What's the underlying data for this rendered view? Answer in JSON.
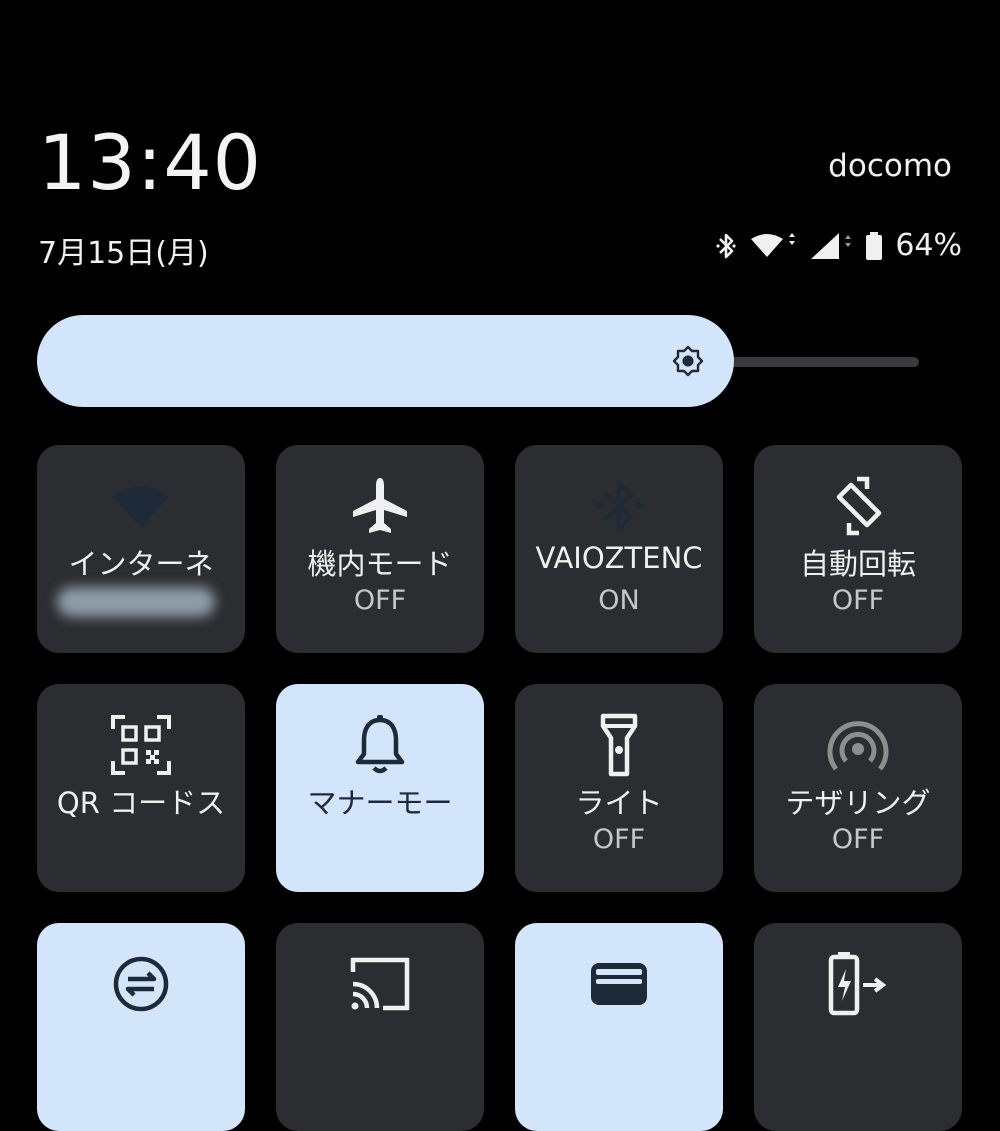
{
  "header": {
    "time": "13:40",
    "carrier": "docomo",
    "date": "7月15日(月)",
    "battery_percent": "64%"
  },
  "brightness": {
    "level": 0.79
  },
  "tiles": [
    {
      "label": "インターネ",
      "sub": "",
      "on": true,
      "icon": "wifi-icon"
    },
    {
      "label": "機内モード",
      "sub": "OFF",
      "on": false,
      "icon": "airplane-icon"
    },
    {
      "label": "VAIOZTENC",
      "sub": "ON",
      "on": true,
      "icon": "bluetooth-icon"
    },
    {
      "label": "自動回転",
      "sub": "OFF",
      "on": false,
      "icon": "rotate-icon"
    },
    {
      "label": "QR コードス",
      "sub": "",
      "on": false,
      "icon": "qr-code-icon"
    },
    {
      "label": "マナーモー",
      "sub": "",
      "on": true,
      "icon": "bell-icon"
    },
    {
      "label": "ライト",
      "sub": "OFF",
      "on": false,
      "icon": "flashlight-icon"
    },
    {
      "label": "テザリング",
      "sub": "OFF",
      "on": false,
      "icon": "hotspot-icon"
    },
    {
      "label": "",
      "sub": "",
      "on": true,
      "icon": "sync-icon"
    },
    {
      "label": "",
      "sub": "",
      "on": false,
      "icon": "cast-icon"
    },
    {
      "label": "",
      "sub": "",
      "on": true,
      "icon": "wallet-icon"
    },
    {
      "label": "",
      "sub": "",
      "on": false,
      "icon": "battery-share-icon"
    }
  ],
  "colors": {
    "tile_on": "#d3e5fb",
    "tile_off": "#2c2d30",
    "background": "#000000"
  }
}
